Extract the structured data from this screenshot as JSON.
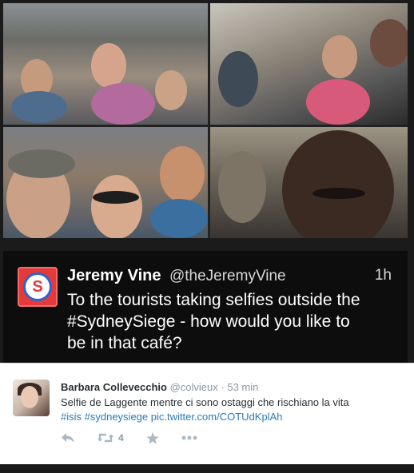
{
  "main_tweet": {
    "avatar_icon": "news-channel-logo-icon",
    "avatar_color": "#e33b3b",
    "name": "Jeremy Vine",
    "handle": "@theJeremyVine",
    "time": "1h",
    "text_line1": "To the tourists taking selfies outside the",
    "text_line2": "#SydneySiege - how would you like to",
    "text_line3": "be in that café?"
  },
  "retweet": {
    "avatar_icon": "user-avatar",
    "name": "Barbara Collevecchio",
    "handle": "@colvieux",
    "separator": "·",
    "time": "53 min",
    "text": "Selfie de Laggente mentre ci sono ostaggi che rischiano la vita",
    "hashtag1": "#isis",
    "hashtag2": "#sydneysiege",
    "link": "pic.twitter.com/COTUdKplAh",
    "actions": {
      "reply_icon": "reply-icon",
      "retweet_icon": "retweet-icon",
      "retweet_count": "4",
      "favorite_icon": "star-icon",
      "more_icon": "more-dots-icon"
    }
  },
  "colors": {
    "link": "#2b7bb9",
    "dark_bg": "#0d0d0d",
    "muted": "#8899a6"
  }
}
